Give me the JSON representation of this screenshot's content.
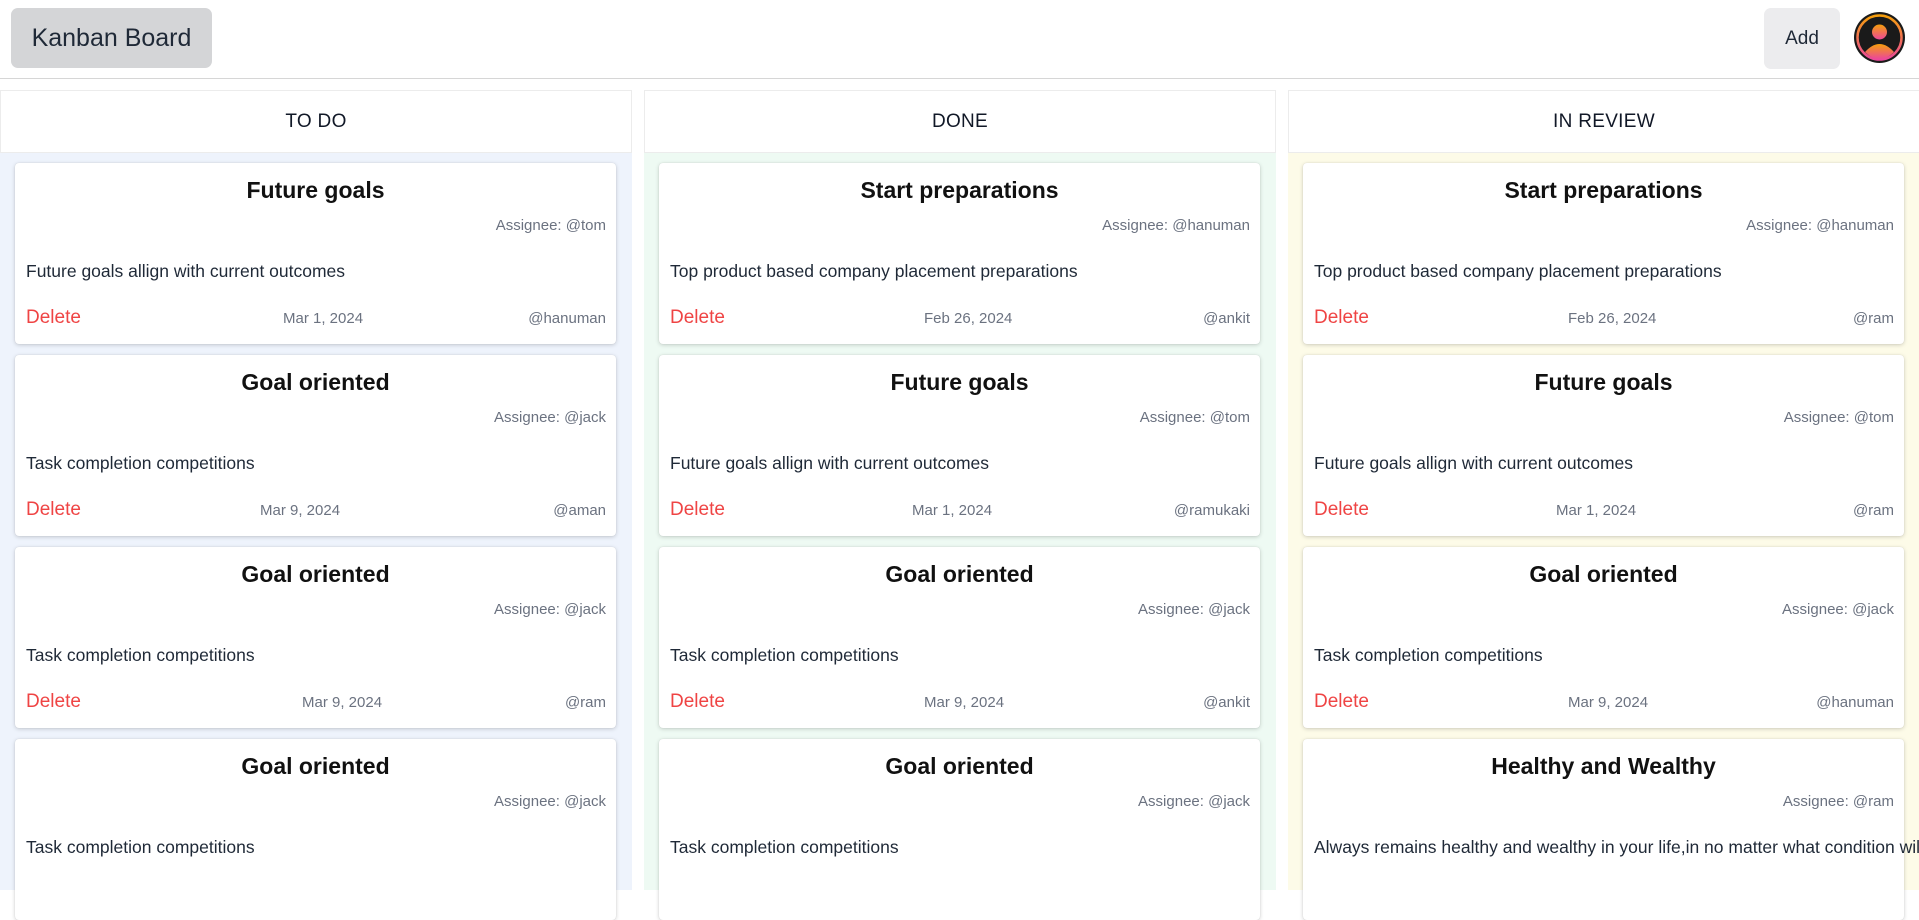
{
  "header": {
    "brand": "Kanban Board",
    "add_label": "Add",
    "avatar_icon": "user-avatar-icon"
  },
  "colors": {
    "todo_bg": "#eef3fc",
    "done_bg": "#eefaf3",
    "review_bg": "#fdfbe8",
    "delete": "#ef4444"
  },
  "columns": [
    {
      "title": "TO DO",
      "cards": [
        {
          "title": "Future goals",
          "assignee": "Assignee: @tom",
          "desc": "Future goals allign with current outcomes",
          "delete": "Delete",
          "date": "Mar 1, 2024",
          "owner": "@hanuman"
        },
        {
          "title": "Goal oriented",
          "assignee": "Assignee: @jack",
          "desc": "Task completion competitions",
          "delete": "Delete",
          "date": "Mar 9, 2024",
          "owner": "@aman"
        },
        {
          "title": "Goal oriented",
          "assignee": "Assignee: @jack",
          "desc": "Task completion competitions",
          "delete": "Delete",
          "date": "Mar 9, 2024",
          "owner": "@ram"
        },
        {
          "title": "Goal oriented",
          "assignee": "Assignee: @jack",
          "desc": "Task completion competitions",
          "delete": "",
          "date": "",
          "owner": ""
        }
      ]
    },
    {
      "title": "DONE",
      "cards": [
        {
          "title": "Start preparations",
          "assignee": "Assignee: @hanuman",
          "desc": "Top product based company placement preparations",
          "delete": "Delete",
          "date": "Feb 26, 2024",
          "owner": "@ankit"
        },
        {
          "title": "Future goals",
          "assignee": "Assignee: @tom",
          "desc": "Future goals allign with current outcomes",
          "delete": "Delete",
          "date": "Mar 1, 2024",
          "owner": "@ramukaki"
        },
        {
          "title": "Goal oriented",
          "assignee": "Assignee: @jack",
          "desc": "Task completion competitions",
          "delete": "Delete",
          "date": "Mar 9, 2024",
          "owner": "@ankit"
        },
        {
          "title": "Goal oriented",
          "assignee": "Assignee: @jack",
          "desc": "Task completion competitions",
          "delete": "",
          "date": "",
          "owner": ""
        }
      ]
    },
    {
      "title": "IN REVIEW",
      "cards": [
        {
          "title": "Start preparations",
          "assignee": "Assignee: @hanuman",
          "desc": "Top product based company placement preparations",
          "delete": "Delete",
          "date": "Feb 26, 2024",
          "owner": "@ram"
        },
        {
          "title": "Future goals",
          "assignee": "Assignee: @tom",
          "desc": "Future goals allign with current outcomes",
          "delete": "Delete",
          "date": "Mar 1, 2024",
          "owner": "@ram"
        },
        {
          "title": "Goal oriented",
          "assignee": "Assignee: @jack",
          "desc": "Task completion competitions",
          "delete": "Delete",
          "date": "Mar 9, 2024",
          "owner": "@hanuman"
        },
        {
          "title": "Healthy and Wealthy",
          "assignee": "Assignee: @ram",
          "desc": "Always remains healthy and wealthy in your life,in no matter what condition will come",
          "delete": "",
          "date": "",
          "owner": ""
        }
      ]
    }
  ]
}
